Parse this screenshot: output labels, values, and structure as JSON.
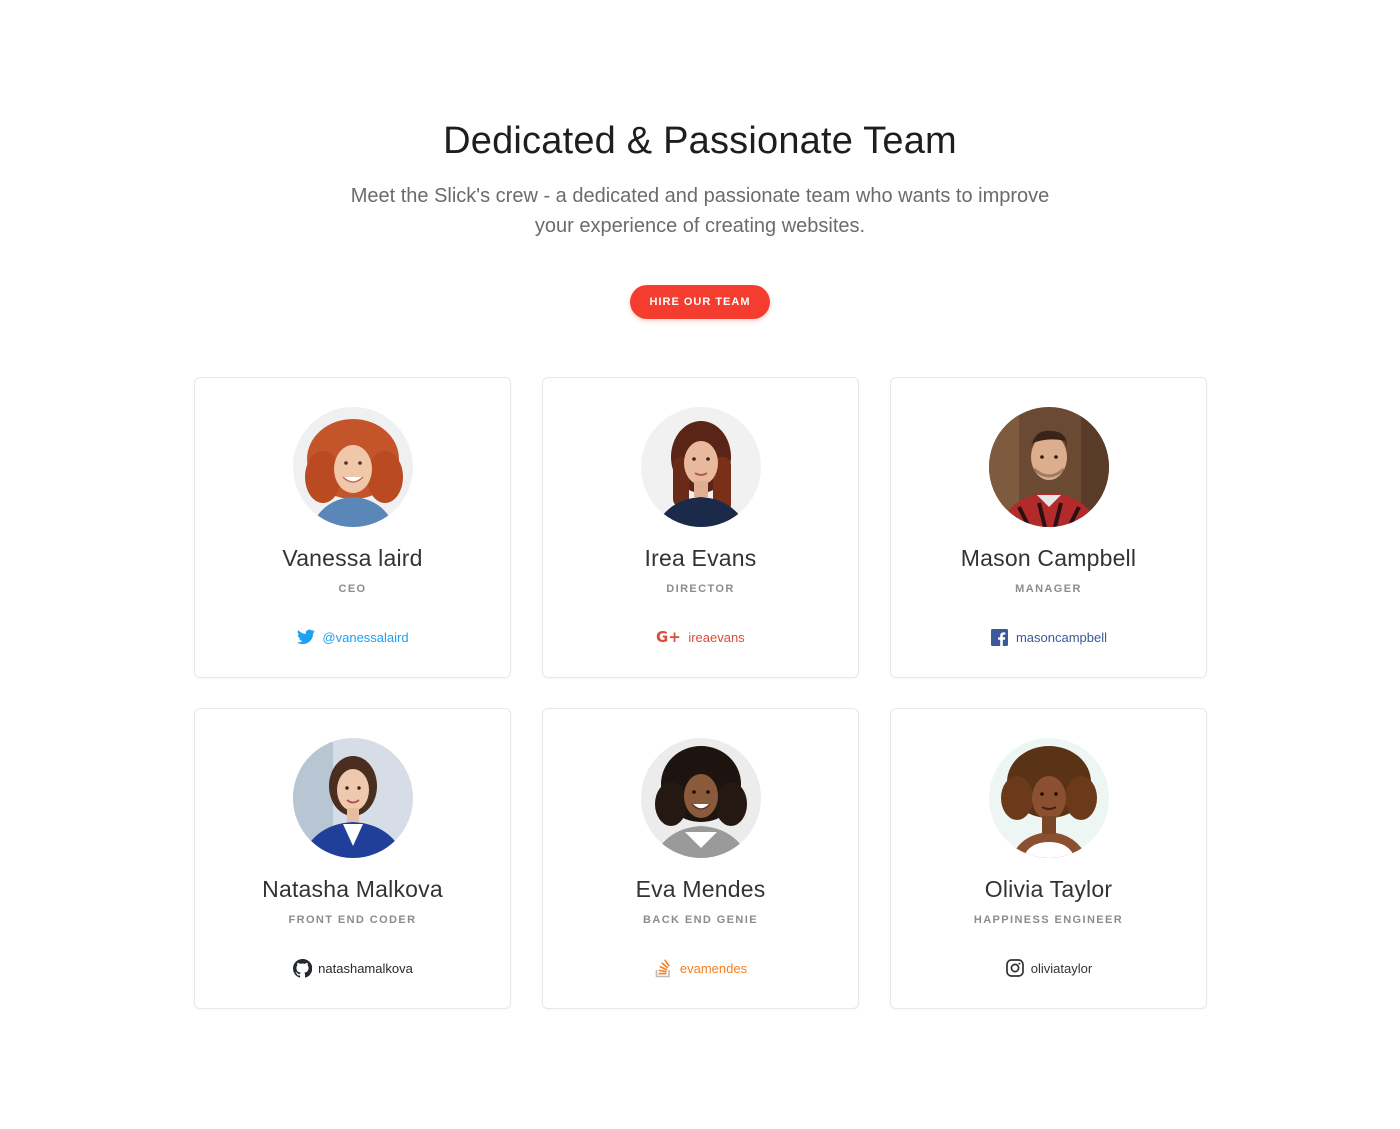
{
  "header": {
    "title": "Dedicated & Passionate Team",
    "subtitle": "Meet the Slick's crew - a dedicated and passionate team who wants to improve your experience of creating websites.",
    "cta_label": "HIRE OUR TEAM"
  },
  "colors": {
    "accent": "#f53d2f",
    "twitter": "#1da1f2",
    "googleplus": "#dd4b39",
    "facebook": "#3b5998",
    "github": "#24292e",
    "stackoverflow": "#f48024",
    "instagram": "#333333"
  },
  "team": [
    {
      "name": "Vanessa laird",
      "role": "CEO",
      "social_icon": "twitter-icon",
      "handle": "@vanessalaird"
    },
    {
      "name": "Irea Evans",
      "role": "DIRECTOR",
      "social_icon": "google-plus-icon",
      "handle": "ireaevans"
    },
    {
      "name": "Mason Campbell",
      "role": "MANAGER",
      "social_icon": "facebook-icon",
      "handle": "masoncampbell"
    },
    {
      "name": "Natasha Malkova",
      "role": "FRONT END CODER",
      "social_icon": "github-icon",
      "handle": "natashamalkova"
    },
    {
      "name": "Eva Mendes",
      "role": "BACK END GENIE",
      "social_icon": "stackoverflow-icon",
      "handle": "evamendes"
    },
    {
      "name": "Olivia Taylor",
      "role": "HAPPINESS ENGINEER",
      "social_icon": "instagram-icon",
      "handle": "oliviataylor"
    }
  ]
}
